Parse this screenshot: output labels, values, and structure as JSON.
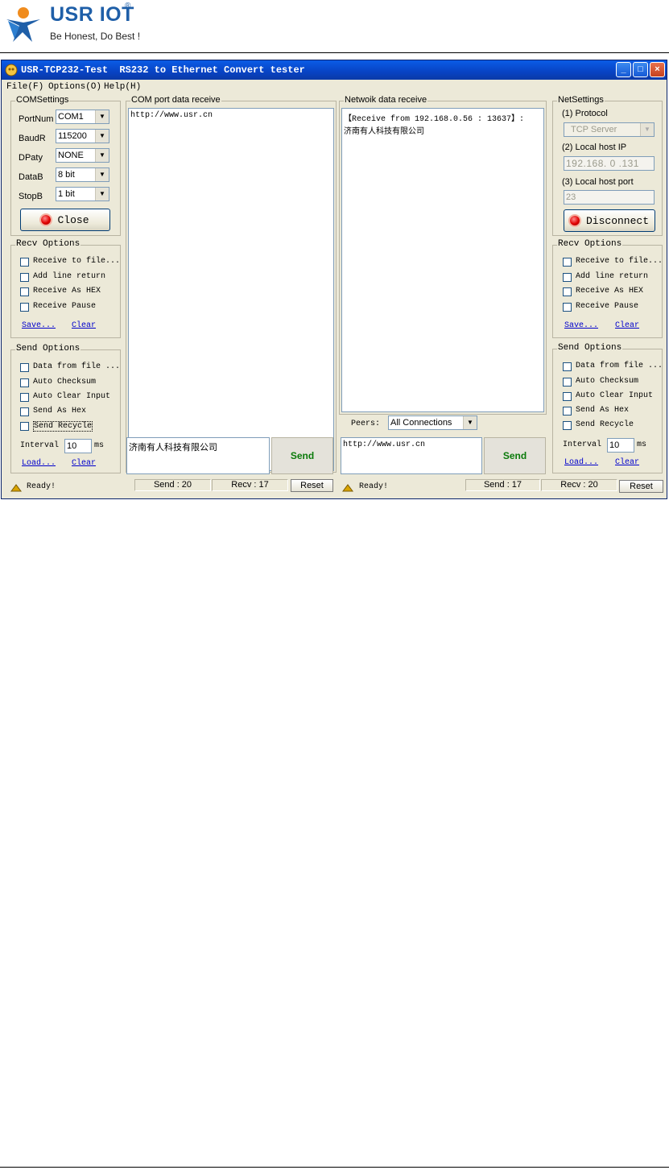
{
  "header": {
    "brand": "USR IOT",
    "registered": "®",
    "slogan": "Be Honest, Do Best !"
  },
  "window": {
    "title": "USR-TCP232-Test  RS232 to Ethernet Convert tester",
    "controls": {
      "minimize": "_",
      "maximize": "□",
      "close": "×"
    },
    "menu": [
      "File(F)",
      "Options(O)",
      "Help(H)"
    ]
  },
  "com_settings": {
    "title": "COMSettings",
    "port_label": "PortNum",
    "port_value": "COM1",
    "baud_label": "BaudR",
    "baud_value": "115200",
    "parity_label": "DPaty",
    "parity_value": "NONE",
    "databits_label": "DataB",
    "databits_value": "8 bit",
    "stopbits_label": "StopB",
    "stopbits_value": "1 bit",
    "close_label": "Close"
  },
  "left_recv_options": {
    "title": "Recv Options",
    "items": [
      "Receive to file...",
      "Add line return",
      "Receive As HEX",
      "Receive Pause"
    ],
    "save_label": "Save...",
    "clear_label": "Clear"
  },
  "left_send_options": {
    "title": "Send Options",
    "items": [
      "Data from file ...",
      "Auto Checksum",
      "Auto Clear Input",
      "Send As Hex",
      "Send Recycle"
    ],
    "interval_label": "Interval",
    "interval_value": "10",
    "interval_unit": "ms",
    "load_label": "Load...",
    "clear_label": "Clear"
  },
  "com_receive": {
    "title": "COM port data receive",
    "content": "http://www.usr.cn"
  },
  "com_send": {
    "input_value": "济南有人科技有限公司",
    "send_label": "Send"
  },
  "network_receive": {
    "title": "Netwoik data receive",
    "content": "【Receive from 192.168.0.56 : 13637】:\n济南有人科技有限公司"
  },
  "peers": {
    "label": "Peers:",
    "value": "All Connections"
  },
  "net_send": {
    "input_value": "http://www.usr.cn",
    "send_label": "Send"
  },
  "net_settings": {
    "title": "NetSettings",
    "protocol_label": "(1) Protocol",
    "protocol_value": "TCP Server",
    "ip_label": "(2) Local host IP",
    "ip_parts": [
      "192",
      "168",
      "0",
      "131"
    ],
    "port_label": "(3) Local host port",
    "port_value": "23",
    "disconnect_label": "Disconnect"
  },
  "right_recv_options": {
    "title": "Recv Options",
    "items": [
      "Receive to file...",
      "Add line return",
      "Receive As HEX",
      "Receive Pause"
    ],
    "save_label": "Save...",
    "clear_label": "Clear"
  },
  "right_send_options": {
    "title": "Send Options",
    "items": [
      "Data from file ...",
      "Auto Checksum",
      "Auto Clear Input",
      "Send As Hex",
      "Send Recycle"
    ],
    "interval_label": "Interval",
    "interval_value": "10",
    "interval_unit": "ms",
    "load_label": "Load...",
    "clear_label": "Clear"
  },
  "status_left": {
    "ready": "Ready!",
    "send": "Send : 20",
    "recv": "Recv : 17",
    "reset": "Reset"
  },
  "status_right": {
    "ready": "Ready!",
    "send": "Send : 17",
    "recv": "Recv : 20",
    "reset": "Reset"
  }
}
